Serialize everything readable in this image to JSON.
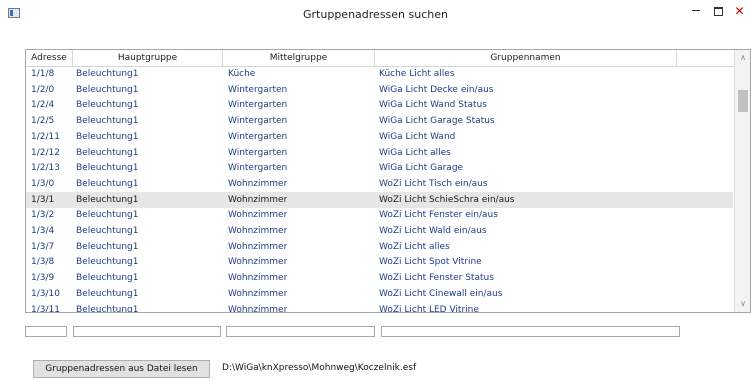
{
  "window": {
    "title": "Grtuppenadressen suchen",
    "min_glyph": "",
    "close_glyph": "✕"
  },
  "grid": {
    "columns": [
      "Adresse",
      "Hauptgruppe",
      "Mittelgruppe",
      "Gruppennamen"
    ],
    "selected_row": 8,
    "rows": [
      [
        "1/1/8",
        "Beleuchtung1",
        "Küche",
        "Küche Licht alles"
      ],
      [
        "1/2/0",
        "Beleuchtung1",
        "Wintergarten",
        "WiGa Licht Decke ein/aus"
      ],
      [
        "1/2/4",
        "Beleuchtung1",
        "Wintergarten",
        "WiGa Licht Wand Status"
      ],
      [
        "1/2/5",
        "Beleuchtung1",
        "Wintergarten",
        "WiGa Licht Garage Status"
      ],
      [
        "1/2/11",
        "Beleuchtung1",
        "Wintergarten",
        "WiGa Licht Wand"
      ],
      [
        "1/2/12",
        "Beleuchtung1",
        "Wintergarten",
        "WiGa Licht alles"
      ],
      [
        "1/2/13",
        "Beleuchtung1",
        "Wintergarten",
        "WiGa Licht Garage"
      ],
      [
        "1/3/0",
        "Beleuchtung1",
        "Wohnzimmer",
        "WoZi Licht Tisch ein/aus"
      ],
      [
        "1/3/1",
        "Beleuchtung1",
        "Wohnzimmer",
        "WoZi Licht SchieSchra ein/aus"
      ],
      [
        "1/3/2",
        "Beleuchtung1",
        "Wohnzimmer",
        "WoZi Licht Fenster ein/aus"
      ],
      [
        "1/3/4",
        "Beleuchtung1",
        "Wohnzimmer",
        "WoZi Licht Wald ein/aus"
      ],
      [
        "1/3/7",
        "Beleuchtung1",
        "Wohnzimmer",
        "WoZi Licht alles"
      ],
      [
        "1/3/8",
        "Beleuchtung1",
        "Wohnzimmer",
        "WoZi Licht Spot Vitrine"
      ],
      [
        "1/3/9",
        "Beleuchtung1",
        "Wohnzimmer",
        "WoZi Licht Fenster Status"
      ],
      [
        "1/3/10",
        "Beleuchtung1",
        "Wohnzimmer",
        "WoZi Licht Cinewall ein/aus"
      ],
      [
        "1/3/11",
        "Beleuchtung1",
        "Wohnzimmer",
        "WoZi Licht LED Vitrine"
      ]
    ]
  },
  "filters": {
    "adresse": "",
    "hauptgruppe": "",
    "mittelgruppe": "",
    "gruppenname": ""
  },
  "footer": {
    "read_button": "Gruppenadressen aus Datei lesen",
    "file_path": "D:\\WiGa\\knXpresso\\Mohnweg\\Koczelnik.esf"
  }
}
